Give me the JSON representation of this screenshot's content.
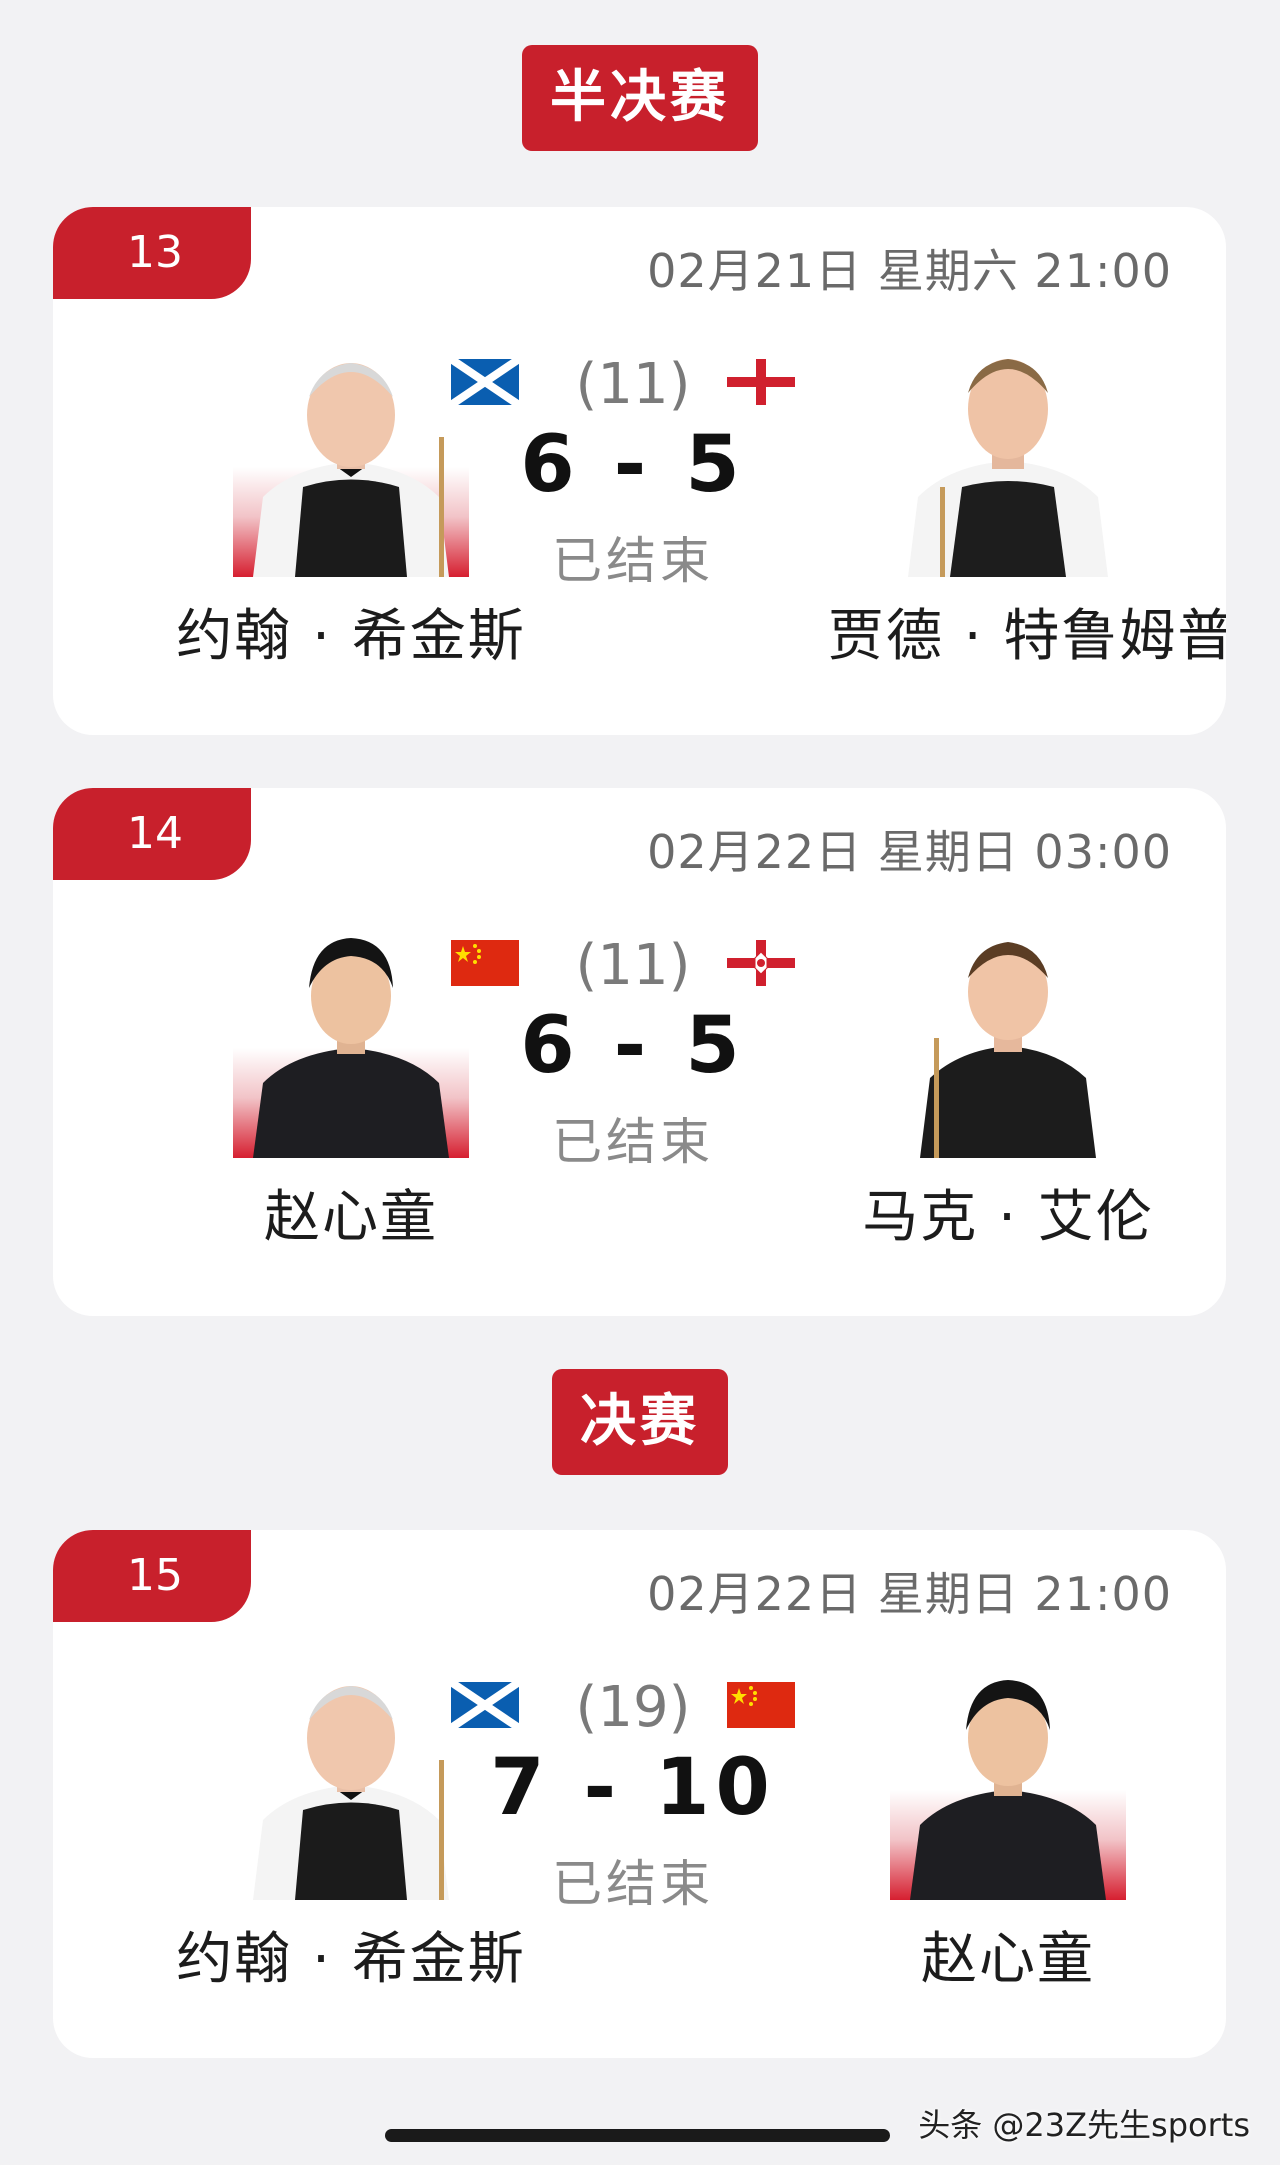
{
  "stage_semifinal": "半决赛",
  "stage_final": "决赛",
  "matches": [
    {
      "number": "13",
      "datetime": "02月21日 星期六 21:00",
      "left_player": "约翰 · 希金斯",
      "right_player": "贾德 · 特鲁姆普",
      "left_flag": "scotland-flag",
      "right_flag": "england-flag",
      "best_of": "(11)",
      "score": "6 - 5",
      "status": "已结束"
    },
    {
      "number": "14",
      "datetime": "02月22日 星期日 03:00",
      "left_player": "赵心童",
      "right_player": "马克 · 艾伦",
      "left_flag": "china-flag",
      "right_flag": "northern-ireland-flag",
      "best_of": "(11)",
      "score": "6 - 5",
      "status": "已结束"
    },
    {
      "number": "15",
      "datetime": "02月22日 星期日 21:00",
      "left_player": "约翰 · 希金斯",
      "right_player": "赵心童",
      "left_flag": "scotland-flag",
      "right_flag": "china-flag",
      "best_of": "(19)",
      "score": "7 - 10",
      "status": "已结束"
    }
  ],
  "watermark": "头条 @23Z先生sports",
  "colors": {
    "accent_red": "#c8202c",
    "page_bg": "#f2f2f4",
    "card_bg": "#ffffff"
  }
}
